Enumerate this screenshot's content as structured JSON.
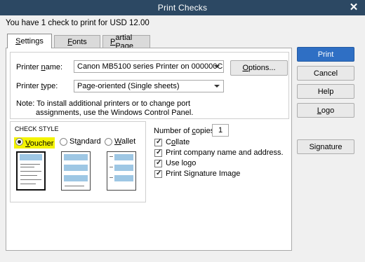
{
  "window": {
    "title": "Print Checks",
    "close": "✕"
  },
  "summary": "You have 1 check to print for USD 12.00",
  "tabs": [
    {
      "label": "Settings",
      "key": "S",
      "rest": "ettings"
    },
    {
      "label": "Fonts",
      "key": "F",
      "rest": "onts"
    },
    {
      "label": "Partial Page",
      "key": "P",
      "rest": "artial Page"
    }
  ],
  "printer": {
    "name_label_pre": "Printer ",
    "name_label_key": "n",
    "name_label_post": "ame:",
    "name_value": "Canon MB5100 series Printer on 000000C...",
    "type_label_pre": "Printer ",
    "type_label_key": "t",
    "type_label_post": "ype:",
    "type_value": "Page-oriented (Single sheets)",
    "options_pre": "",
    "options_key": "O",
    "options_post": "ptions...",
    "note_line1": "Note: To install additional printers or to change port",
    "note_line2": "assignments, use the Windows Control Panel."
  },
  "check_style": {
    "title": "CHECK STYLE",
    "options": [
      {
        "label": "Voucher",
        "key": "V",
        "rest": "oucher",
        "selected": true
      },
      {
        "label": "Standard",
        "pre": "St",
        "key": "a",
        "rest": "ndard",
        "selected": false
      },
      {
        "label": "Wallet",
        "key": "W",
        "rest": "allet",
        "selected": false
      }
    ]
  },
  "copies": {
    "label_pre": "Number of ",
    "label_key": "c",
    "label_post": "opies:",
    "value": "1"
  },
  "checkboxes": [
    {
      "pre": "C",
      "key": "o",
      "post": "llate",
      "checked": true
    },
    {
      "pre": "Print company name and address.",
      "key": "",
      "post": "",
      "checked": true
    },
    {
      "pre": "Use logo",
      "key": "",
      "post": "",
      "checked": true
    },
    {
      "pre": "Print Signature Image",
      "key": "",
      "post": "",
      "checked": true
    }
  ],
  "right_buttons": {
    "print": "Print",
    "cancel": "Cancel",
    "help": "Help",
    "logo_key": "L",
    "logo_rest": "ogo",
    "signature": "Signature"
  },
  "colors": {
    "titlebar": "#2c4863",
    "primary": "#2f6fc4",
    "highlight": "#f3f300",
    "check_band": "#9ec7e4"
  }
}
